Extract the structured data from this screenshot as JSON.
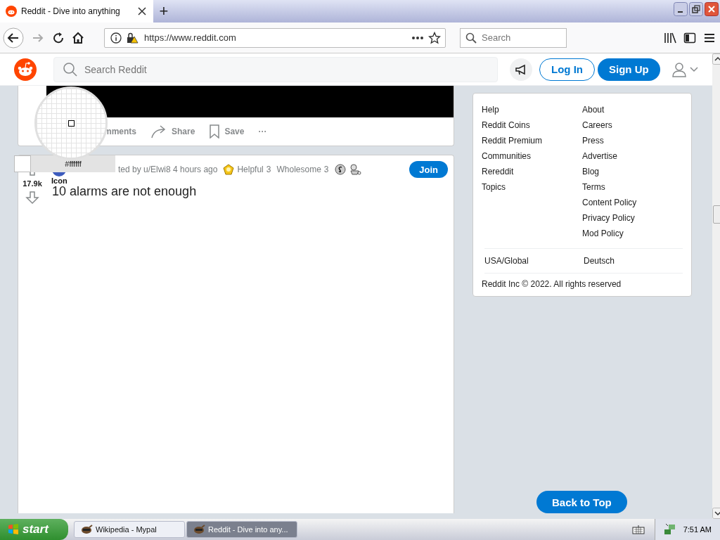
{
  "browser": {
    "tab_title": "Reddit - Dive into anything",
    "new_tab": "+",
    "url": "https://www.reddit.com",
    "search_placeholder": "Search"
  },
  "header": {
    "search_placeholder": "Search Reddit",
    "login": "Log In",
    "signup": "Sign Up"
  },
  "post_above": {
    "actions": [
      {
        "kind": "comments",
        "label": "mments"
      },
      {
        "kind": "share",
        "label": "Share"
      },
      {
        "kind": "save",
        "label": "Save"
      },
      {
        "kind": "more",
        "label": "···"
      }
    ]
  },
  "post": {
    "votes": "17.9k",
    "byline": "ted by u/Elwi8 4 hours ago",
    "awards": [
      {
        "kind": "helpful",
        "label": "Helpful",
        "count": "3"
      },
      {
        "kind": "wholesome",
        "label": "Wholesome",
        "count": "3"
      },
      {
        "kind": "silver"
      },
      {
        "kind": "other"
      }
    ],
    "join": "Join",
    "title": "10 alarms are not enough"
  },
  "tooltip": "Icon",
  "color_picker": {
    "hex": "#ffffff"
  },
  "sidebar": {
    "column_1": [
      "Help",
      "Reddit Coins",
      "Reddit Premium",
      "Communities",
      "Rereddit",
      "Topics"
    ],
    "column_2": [
      "About",
      "Careers",
      "Press",
      "Advertise",
      "Blog",
      "Terms",
      "Content Policy",
      "Privacy Policy",
      "Mod Policy"
    ],
    "languages": [
      "USA/Global",
      "Deutsch"
    ],
    "copyright": "Reddit Inc © 2022. All rights reserved"
  },
  "back_to_top": "Back to Top",
  "taskbar": {
    "start": "start",
    "tasks": [
      {
        "label": "Wikipedia - Mypal",
        "selected": false
      },
      {
        "label": "Reddit - Dive into any...",
        "selected": true
      }
    ],
    "clock": "7:51 AM"
  }
}
